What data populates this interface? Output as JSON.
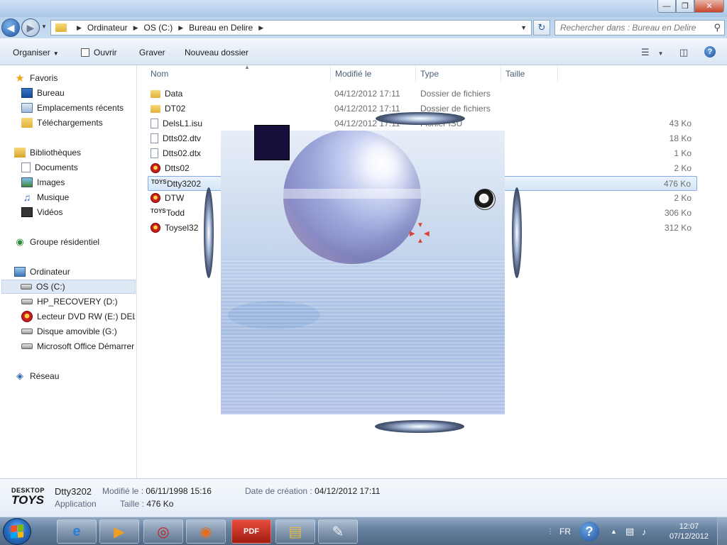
{
  "window": {
    "minimize": "—",
    "maximize": "❐",
    "close": "✕"
  },
  "address": {
    "crumbs": [
      "Ordinateur",
      "OS (C:)",
      "Bureau en Delire"
    ],
    "search_placeholder": "Rechercher dans : Bureau en Delire"
  },
  "toolbar": {
    "organize": "Organiser",
    "open": "Ouvrir",
    "burn": "Graver",
    "new_folder": "Nouveau dossier"
  },
  "nav": {
    "favorites": "Favoris",
    "desktop": "Bureau",
    "recent": "Emplacements récents",
    "downloads": "Téléchargements",
    "libraries": "Bibliothèques",
    "documents": "Documents",
    "images": "Images",
    "music": "Musique",
    "videos": "Vidéos",
    "homegroup": "Groupe résidentiel",
    "computer": "Ordinateur",
    "drive_c": "OS (C:)",
    "drive_d": "HP_RECOVERY (D:)",
    "drive_e": "Lecteur DVD RW (E:) DELIR",
    "drive_g": "Disque amovible (G:)",
    "office": "Microsoft Office Démarrer",
    "network": "Réseau"
  },
  "columns": {
    "name": "Nom",
    "modified": "Modifié le",
    "type": "Type",
    "size": "Taille"
  },
  "files": [
    {
      "name": "Data",
      "date": "04/12/2012 17:11",
      "type": "Dossier de fichiers",
      "size": "",
      "icon": "folder-icon"
    },
    {
      "name": "DT02",
      "date": "04/12/2012 17:11",
      "type": "Dossier de fichiers",
      "size": "",
      "icon": "folder-icon"
    },
    {
      "name": "DelsL1.isu",
      "date": "04/12/2012 17:11",
      "type": "Fichier ISU",
      "size": "43 Ko",
      "icon": "file-icon"
    },
    {
      "name": "Dtts02.dtv",
      "date": "",
      "type": "",
      "size": "18 Ko",
      "icon": "file-icon"
    },
    {
      "name": "Dtts02.dtx",
      "date": "",
      "type": "",
      "size": "1 Ko",
      "icon": "file-icon"
    },
    {
      "name": "Dtts02",
      "date": "",
      "type": "",
      "size": "2 Ko",
      "icon": "desktop-toys-icon"
    },
    {
      "name": "Dtty3202",
      "date": "",
      "type": "",
      "size": "476 Ko",
      "icon": "toys-logo-icon"
    },
    {
      "name": "DTW",
      "date": "",
      "type": "",
      "size": "2 Ko",
      "icon": "desktop-toys-icon"
    },
    {
      "name": "Todd",
      "date": "",
      "type": "",
      "size": "306 Ko",
      "icon": "toys-logo-icon"
    },
    {
      "name": "Toysel32",
      "date": "",
      "type": "",
      "size": "312 Ko",
      "icon": "desktop-toys-icon"
    }
  ],
  "details": {
    "logo_top": "DESKTOP",
    "logo_bottom": "TOYS",
    "name": "Dtty3202",
    "kind": "Application",
    "modified_label": "Modifié le :",
    "modified_value": "06/11/1998 15:16",
    "size_label": "Taille :",
    "size_value": "476 Ko",
    "created_label": "Date de création :",
    "created_value": "04/12/2012 17:11"
  },
  "taskbar": {
    "lang": "FR",
    "time": "12:07",
    "date": "07/12/2012",
    "pdf_label": "PDF"
  },
  "colors": {
    "accent": "#2a6fc4",
    "selection": "#d5e6f9",
    "taskbar": "#647f9d"
  }
}
